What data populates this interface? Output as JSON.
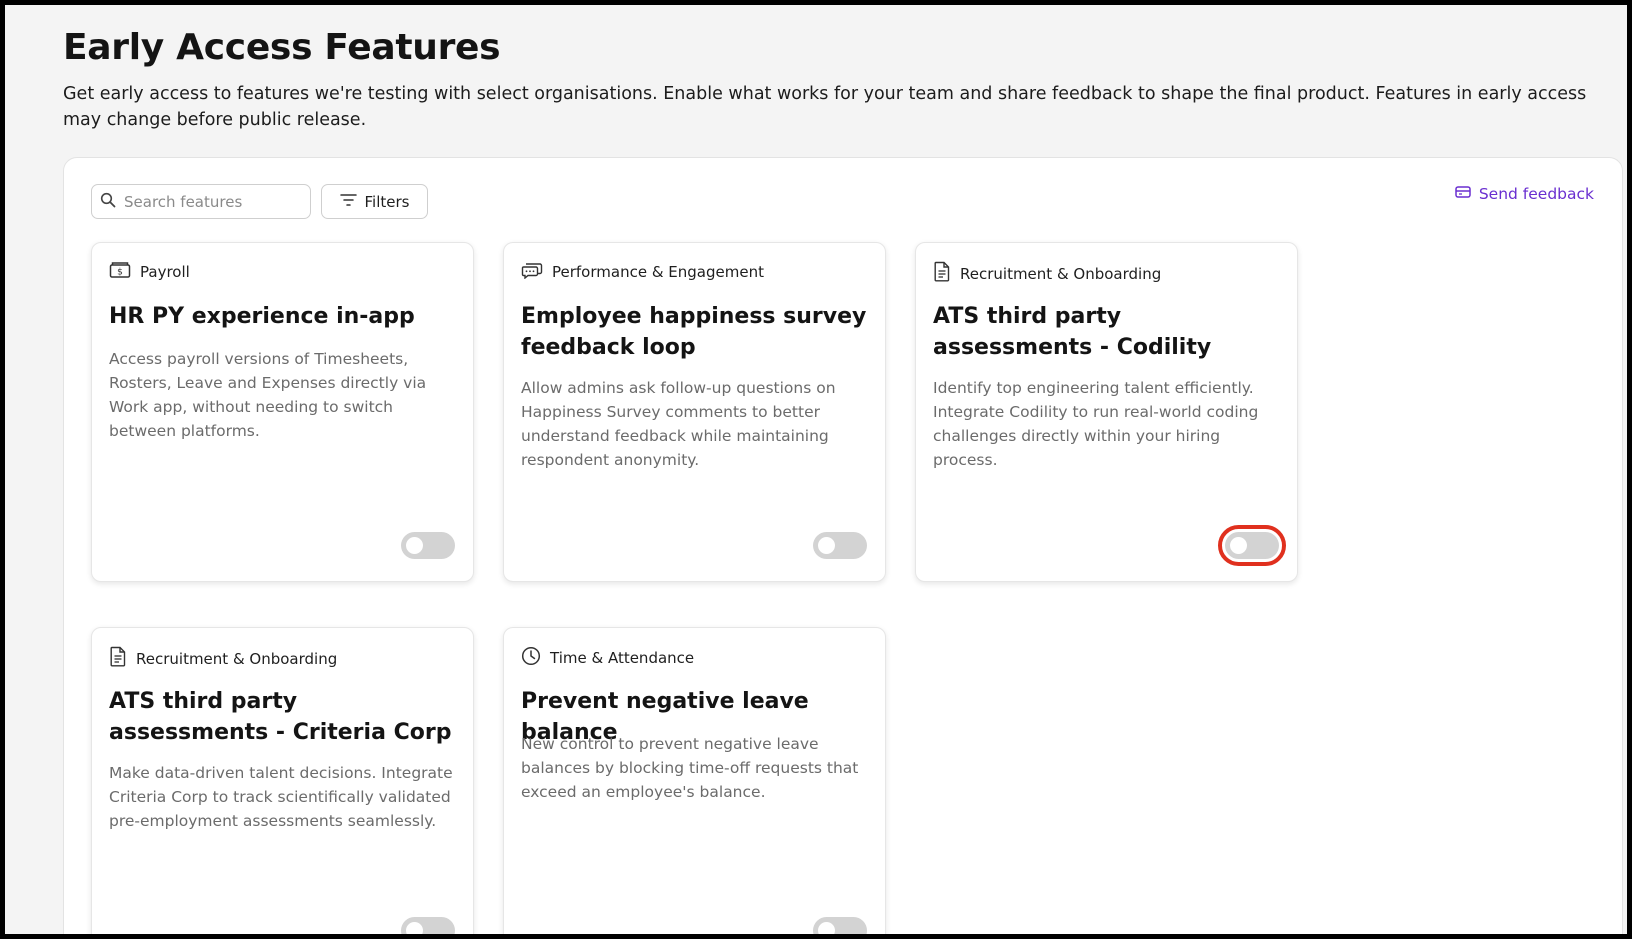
{
  "header": {
    "title": "Early Access Features",
    "description": "Get early access to features we're testing with select organisations. Enable what works for your team and share feedback to shape the final product. Features in early access may change before public release."
  },
  "toolbar": {
    "search_placeholder": "Search features",
    "filters_label": "Filters",
    "feedback_label": "Send feedback"
  },
  "cards": [
    {
      "category": "Payroll",
      "category_icon": "payroll-cash-icon",
      "title": "HR PY experience in-app",
      "description": "Access payroll versions of Timesheets, Rosters, Leave and Expenses directly via Work app, without needing to switch between platforms.",
      "enabled": false
    },
    {
      "category": "Performance & Engagement",
      "category_icon": "chat-bubble-icon",
      "title": "Employee happiness survey feedback loop",
      "description": "Allow admins ask follow-up questions on Happiness Survey comments to better understand feedback while maintaining respondent anonymity.",
      "enabled": false
    },
    {
      "category": "Recruitment & Onboarding",
      "category_icon": "document-icon",
      "title": "ATS third party assessments - Codility",
      "description": "Identify top engineering talent efficiently. Integrate Codility to run real-world coding challenges directly within your hiring process.",
      "enabled": false
    },
    {
      "category": "Recruitment & Onboarding",
      "category_icon": "document-icon",
      "title": "ATS third party assessments - Criteria Corp",
      "description": "Make data-driven talent decisions. Integrate Criteria Corp to track scientifically validated pre-employment assessments seamlessly.",
      "enabled": false
    },
    {
      "category": "Time & Attendance",
      "category_icon": "clock-icon",
      "title": "Prevent negative leave balance",
      "description": "New control to prevent negative leave balances by blocking time-off requests that exceed an employee's balance.",
      "enabled": false
    }
  ],
  "colors": {
    "accent": "#6a2fd0",
    "highlight": "#e0301e",
    "toggle_off": "#d3d3d3",
    "background": "#f4f4f4"
  }
}
